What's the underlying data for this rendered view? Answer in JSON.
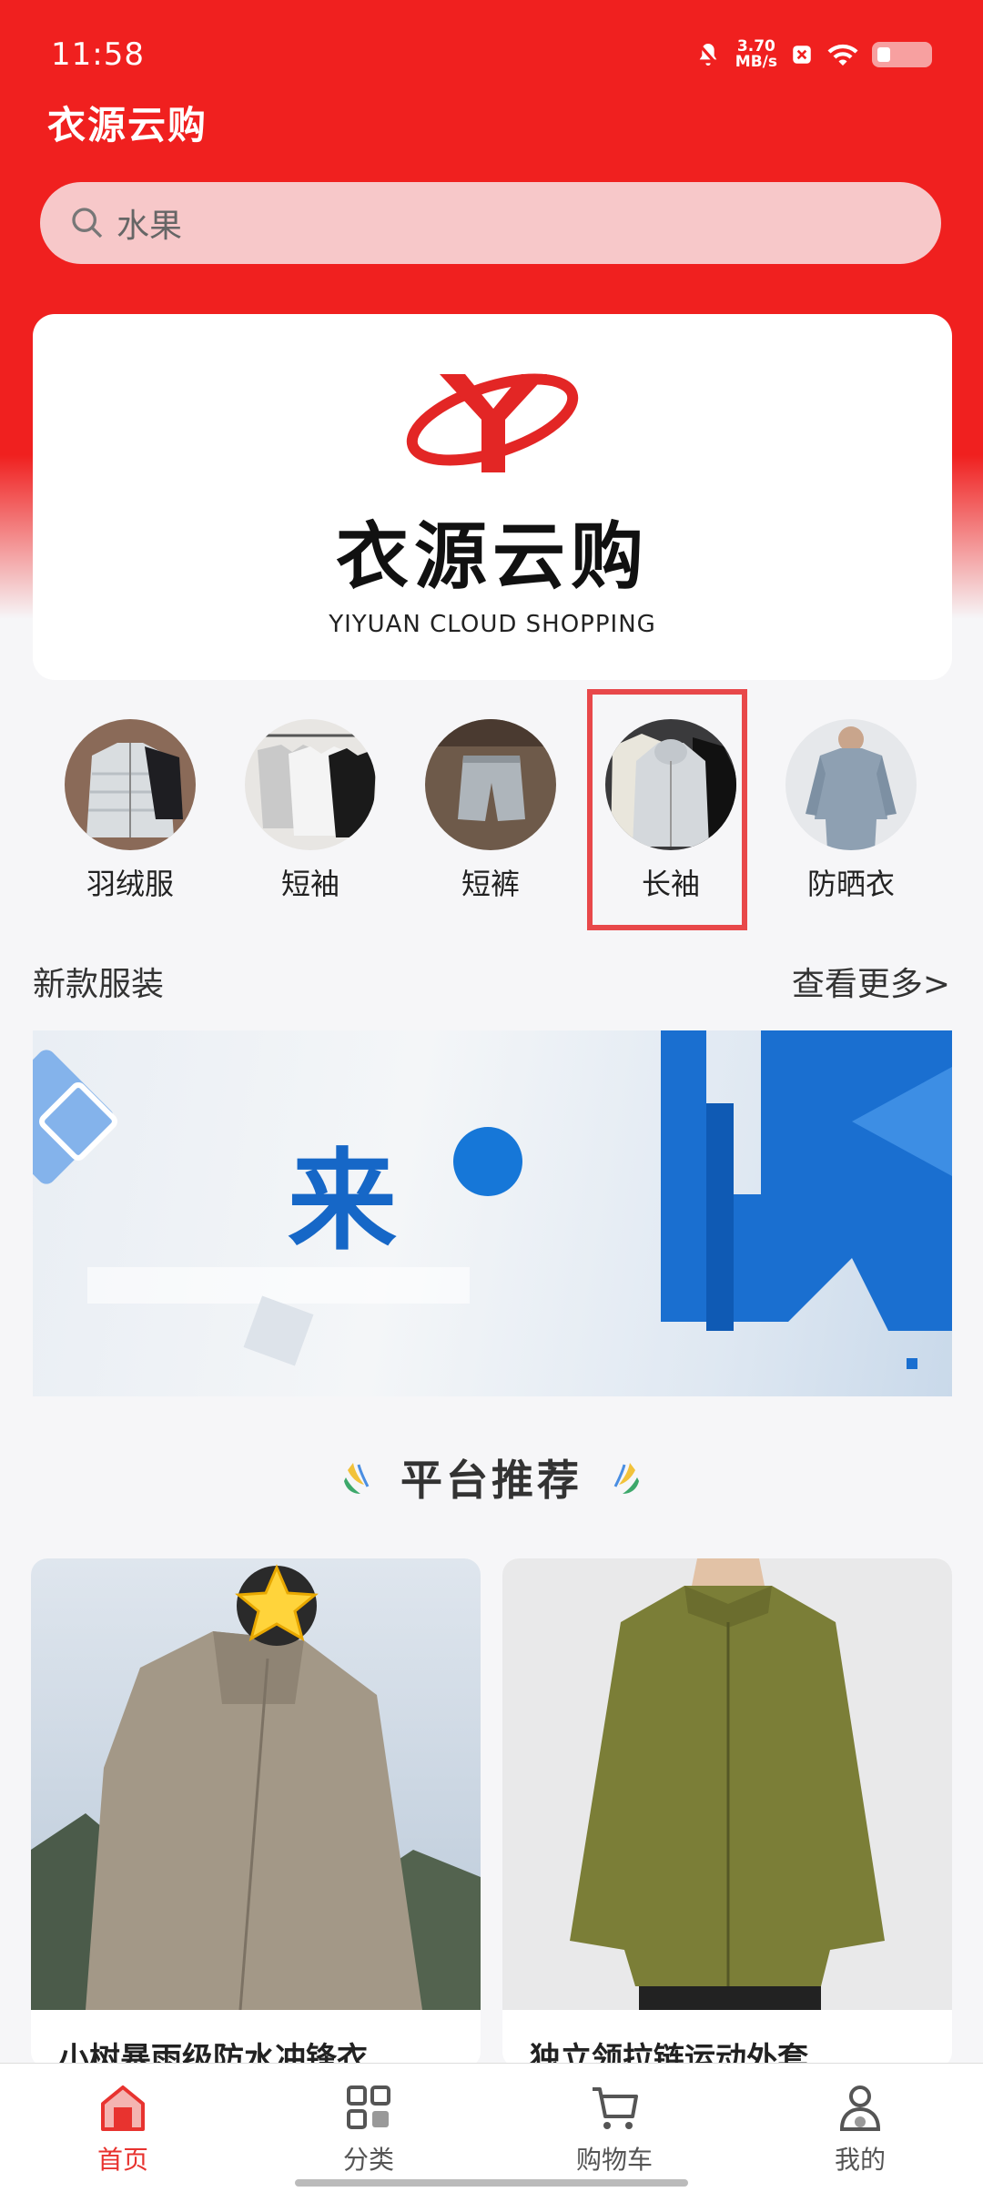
{
  "status_bar": {
    "time": "11:58",
    "speed_value": "3.70",
    "speed_unit": "MB/s"
  },
  "header": {
    "title": "衣源云购"
  },
  "search": {
    "placeholder": "水果"
  },
  "banner": {
    "logo_cn": "衣源云购",
    "logo_en": "YIYUAN CLOUD SHOPPING"
  },
  "categories": [
    {
      "label": "羽绒服",
      "icon": "down-jacket-thumb"
    },
    {
      "label": "短袖",
      "icon": "tshirt-thumb"
    },
    {
      "label": "短裤",
      "icon": "shorts-thumb"
    },
    {
      "label": "长袖",
      "icon": "long-sleeve-thumb"
    },
    {
      "label": "防晒衣",
      "icon": "sun-protection-thumb"
    }
  ],
  "new_section": {
    "title": "新款服装",
    "more": "查看更多>"
  },
  "promo": {
    "text": "来"
  },
  "recommend": {
    "title": "平台推荐"
  },
  "products": [
    {
      "name": "小树暴雨级防水冲锋衣"
    },
    {
      "name": "独立领拉链运动外套"
    }
  ],
  "tabs": [
    {
      "label": "首页",
      "icon": "home-icon",
      "active": true
    },
    {
      "label": "分类",
      "icon": "category-icon",
      "active": false
    },
    {
      "label": "购物车",
      "icon": "cart-icon",
      "active": false
    },
    {
      "label": "我的",
      "icon": "user-icon",
      "active": false
    }
  ],
  "colors": {
    "brand_red": "#f0201f",
    "active_tab": "#e8332f"
  }
}
